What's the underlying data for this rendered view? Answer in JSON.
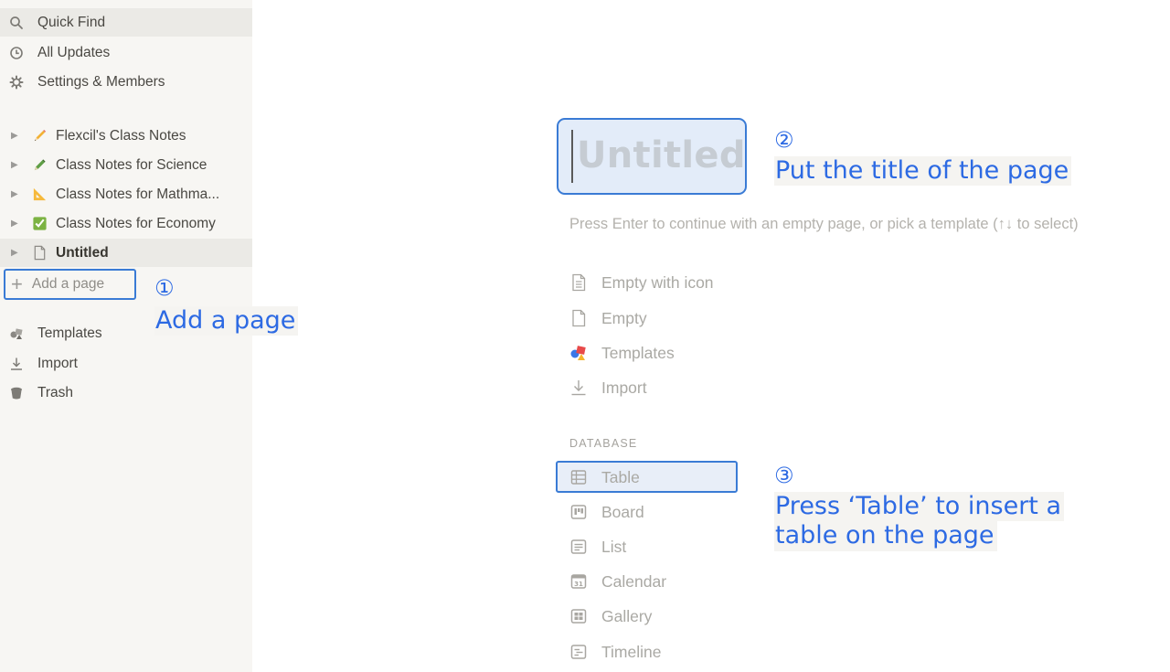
{
  "sidebar": {
    "top_items": [
      {
        "label": "Quick Find",
        "icon": "search-icon"
      },
      {
        "label": "All Updates",
        "icon": "clock-icon"
      },
      {
        "label": "Settings & Members",
        "icon": "gear-icon"
      }
    ],
    "pages": [
      {
        "label": "Flexcil's Class Notes",
        "icon": "pencil-icon"
      },
      {
        "label": "Class Notes for Science",
        "icon": "pen-icon"
      },
      {
        "label": "Class Notes for Mathma...",
        "icon": "triangle-ruler-icon"
      },
      {
        "label": "Class Notes for Economy",
        "icon": "checkbox-icon"
      },
      {
        "label": "Untitled",
        "icon": "page-icon"
      }
    ],
    "add_page_label": "Add a page",
    "bottom_items": [
      {
        "label": "Templates",
        "icon": "templates-icon"
      },
      {
        "label": "Import",
        "icon": "import-icon"
      },
      {
        "label": "Trash",
        "icon": "trash-icon"
      }
    ]
  },
  "annotations": {
    "step1": {
      "number": "①",
      "text": "Add a page"
    },
    "step2": {
      "number": "②",
      "text": "Put the title of the page"
    },
    "step3": {
      "number": "③",
      "line1": "Press ‘Table’ to insert a",
      "line2": "table on the page"
    }
  },
  "main": {
    "title_placeholder": "Untitled",
    "hint": "Press Enter to continue with an empty page, or pick a template (↑↓ to select)",
    "options": [
      {
        "label": "Empty with icon",
        "icon": "page-with-lines-icon"
      },
      {
        "label": "Empty",
        "icon": "page-icon"
      },
      {
        "label": "Templates",
        "icon": "templates-icon"
      },
      {
        "label": "Import",
        "icon": "import-icon"
      }
    ],
    "database_heading": "DATABASE",
    "database_options": [
      {
        "label": "Table",
        "icon": "table-icon"
      },
      {
        "label": "Board",
        "icon": "board-icon"
      },
      {
        "label": "List",
        "icon": "list-icon"
      },
      {
        "label": "Calendar",
        "icon": "calendar-icon"
      },
      {
        "label": "Gallery",
        "icon": "gallery-icon"
      },
      {
        "label": "Timeline",
        "icon": "timeline-icon"
      }
    ]
  },
  "colors": {
    "annotation": "#2d6ae3",
    "highlight_border": "#3a7bd5",
    "sidebar_bg": "#f7f6f3",
    "muted_text": "#aaa9a4"
  }
}
